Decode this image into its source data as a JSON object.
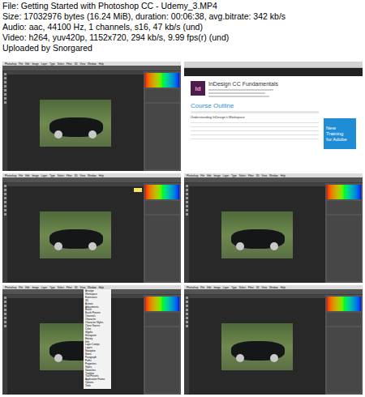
{
  "header": {
    "lines": [
      "File: Getting Started with Photoshop CC - Udemy_3.MP4",
      "Size: 17032976 bytes (16.24 MiB), duration: 00:06:38, avg.bitrate: 342 kb/s",
      "Audio: aac, 44100 Hz, 1 channels, s16, 47 kb/s (und)",
      "Video: h264, yuv420p, 1152x720, 294 kb/s, 9.99 fps(r) (und)",
      "Uploaded by Snorgared"
    ]
  },
  "photoshop_menu": [
    "Photoshop",
    "File",
    "Edit",
    "Image",
    "Layer",
    "Type",
    "Select",
    "Filter",
    "3D",
    "View",
    "Window",
    "Help"
  ],
  "window_menu": [
    "Arrange",
    "Workspace",
    "Extensions",
    "3D",
    "Actions",
    "Adjustments",
    "Brush",
    "Brush Presets",
    "Channels",
    "Character",
    "Character Styles",
    "Clone Source",
    "Color",
    "Glyphs",
    "Histogram",
    "History",
    "Info",
    "Layer Comps",
    "Layers",
    "Navigator",
    "Notes",
    "Paragraph",
    "Paths",
    "Properties",
    "Styles",
    "Swatches",
    "Timeline",
    "Tool Presets",
    "Application Frame",
    "Options",
    "Tools"
  ],
  "frames": [
    {
      "kind": "photoshop",
      "tooltip": false,
      "window_menu_open": false
    },
    {
      "kind": "browser",
      "title": "InDesign CC Fundamentals",
      "logo": "Id",
      "course_outline": "Course Outline",
      "section": "Understanding InDesign's Workspace",
      "ad_lines": [
        "New",
        "Training",
        "for Adobe"
      ]
    },
    {
      "kind": "photoshop",
      "tooltip": true,
      "window_menu_open": false
    },
    {
      "kind": "photoshop",
      "tooltip": false,
      "window_menu_open": false
    },
    {
      "kind": "photoshop",
      "tooltip": false,
      "window_menu_open": true
    },
    {
      "kind": "photoshop",
      "tooltip": false,
      "window_menu_open": false
    }
  ]
}
